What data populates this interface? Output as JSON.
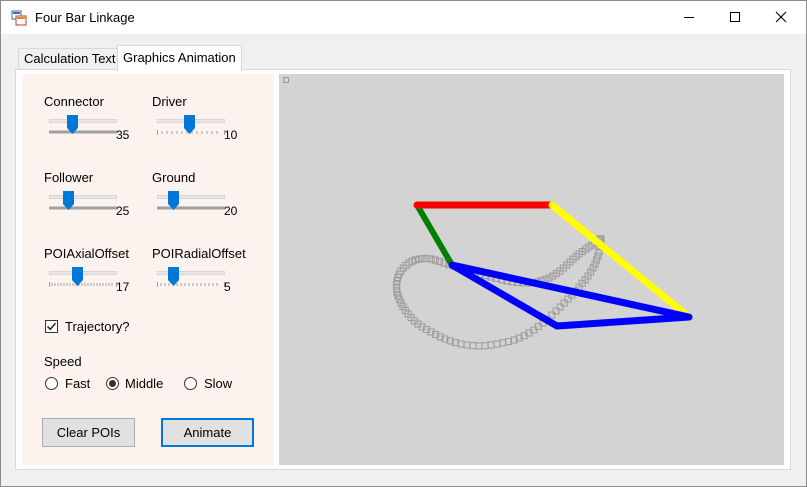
{
  "window": {
    "title": "Four Bar Linkage"
  },
  "tabs": [
    {
      "label": "Calculation Text"
    },
    {
      "label": "Graphics Animation"
    }
  ],
  "controls": {
    "connector": {
      "label": "Connector",
      "value": "35"
    },
    "driver": {
      "label": "Driver",
      "value": "10"
    },
    "follower": {
      "label": "Follower",
      "value": "25"
    },
    "ground": {
      "label": "Ground",
      "value": "20"
    },
    "poi_axial": {
      "label": "POIAxialOffset",
      "value": "17"
    },
    "poi_radial": {
      "label": "POIRadialOffset",
      "value": "5"
    },
    "trajectory": {
      "label": "Trajectory?",
      "checked": true
    },
    "speed": {
      "label": "Speed",
      "options": [
        "Fast",
        "Middle",
        "Slow"
      ],
      "selected": "Middle"
    },
    "clear_button": "Clear POIs",
    "animate_button": "Animate"
  },
  "colors": {
    "panel_bg": "#fdf3ee",
    "canvas_bg": "#d3d3d3",
    "coupler": "#ff0000",
    "driver_link": "#008000",
    "follower_link": "#ffff00",
    "triangle": "#0000ff",
    "trajectory": "#9a9a9a",
    "accent": "#0078d7"
  }
}
